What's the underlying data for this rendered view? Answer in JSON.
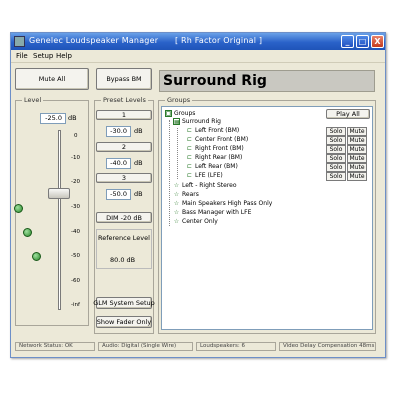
{
  "window": {
    "title": "Genelec Loudspeaker Manager",
    "subtitle": "[ Rh Factor Original ]",
    "controls": [
      "_",
      "□",
      "X"
    ]
  },
  "menu": [
    "File",
    "Setup",
    "Help"
  ],
  "toolbar": {
    "mute_all": "Mute All",
    "bypass_bm": "Bypass BM",
    "rig_name": "Surround Rig"
  },
  "level": {
    "label": "Level",
    "value": "-25.0",
    "unit": "dB",
    "ticks": [
      "0",
      "-10",
      "-20",
      "-30",
      "-40",
      "-50",
      "-60",
      "-inf"
    ]
  },
  "presets": {
    "label": "Preset Levels",
    "items": [
      {
        "number": "1",
        "value": "-30.0",
        "unit": "dB"
      },
      {
        "number": "2",
        "value": "-40.0",
        "unit": "dB"
      },
      {
        "number": "3",
        "value": "-50.0",
        "unit": "dB"
      }
    ],
    "dim": "DIM -20 dB",
    "ref_label": "Reference Level",
    "ref_value": "80.0 dB",
    "glm_setup": "GLM System Setup",
    "show_fader": "Show Fader Only"
  },
  "groups": {
    "label": "Groups",
    "play_all": "Play All",
    "tree": [
      {
        "text": "Groups",
        "level": 0,
        "icon": "folder-icon"
      },
      {
        "text": "Surround Rig",
        "level": 1,
        "icon": "group-icon"
      },
      {
        "text": "Left Front (BM)",
        "level": 2,
        "icon": "speaker-icon",
        "buttons": true
      },
      {
        "text": "Center Front (BM)",
        "level": 2,
        "icon": "speaker-icon",
        "buttons": true
      },
      {
        "text": "Right Front (BM)",
        "level": 2,
        "icon": "speaker-icon",
        "buttons": true
      },
      {
        "text": "Right Rear (BM)",
        "level": 2,
        "icon": "speaker-icon",
        "buttons": true
      },
      {
        "text": "Left Rear (BM)",
        "level": 2,
        "icon": "speaker-icon",
        "buttons": true
      },
      {
        "text": "LFE (LFE)",
        "level": 2,
        "icon": "speaker-icon",
        "buttons": true
      },
      {
        "text": "Left - Right Stereo",
        "level": 1,
        "icon": "group-icon"
      },
      {
        "text": "Rears",
        "level": 1,
        "icon": "group-icon"
      },
      {
        "text": "Main Speakers High Pass Only",
        "level": 1,
        "icon": "group-icon"
      },
      {
        "text": "Bass Manager with LFE",
        "level": 1,
        "icon": "group-icon"
      },
      {
        "text": "Center Only",
        "level": 1,
        "icon": "group-icon"
      }
    ],
    "solo": "Solo",
    "mute": "Mute"
  },
  "status": {
    "network": "Network Status: OK",
    "audio": "Audio: Digital (Single Wire)",
    "loudspeakers": "Loudspeakers: 6",
    "video": "Video Delay Compensation 48ms"
  }
}
